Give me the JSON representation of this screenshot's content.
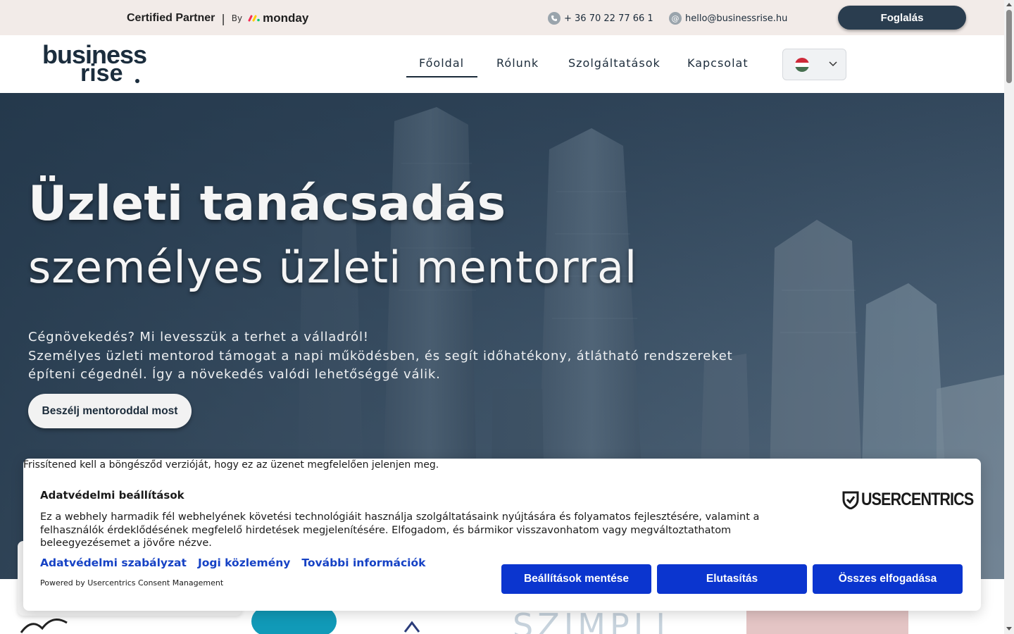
{
  "topbar": {
    "partner_label": "Certified Partner",
    "separator": "|",
    "by_label": "By",
    "brand": "monday",
    "phone": "+ 36 70 22 77 66 1",
    "email": "hello@businessrise.hu",
    "book_button": "Foglalás",
    "phone_icon": "phone-icon",
    "email_icon": "at-icon"
  },
  "logo": {
    "line1": "business",
    "line2": "rise"
  },
  "nav": {
    "items": [
      "Főoldal",
      "Rólunk",
      "Szolgáltatások",
      "Kapcsolat"
    ],
    "active": "Főoldal",
    "language_flag": "hungary-flag-icon"
  },
  "hero": {
    "title": "Üzleti tanácsadás",
    "subtitle": "személyes üzleti mentorral",
    "paragraph_lines": [
      "Cégnövekedés? Mi levesszük a terhet a válladról!",
      "Személyes üzleti mentorod támogat a napi működésben, és segít időhatékony, átlátható rendszereket",
      "építeni cégednél. Így a növekedés valódi lehetőséggé válik."
    ],
    "cta": "Beszélj mentoroddal most"
  },
  "consent": {
    "update_note": "Frissítened kell a böngésződ verzióját, hogy ez az üzenet megfelelően jelenjen meg.",
    "title": "Adatvédelmi beállítások",
    "provider_logo": "USERCENTRICS",
    "description": "Ez a webhely harmadik fél webhelyének követési technológiáit használja szolgáltatásaink nyújtására és folyamatos fejlesztésére, valamint a felhasználók érdeklődésének megfelelő hirdetések megjelenítésére. Elfogadom, és bármikor visszavonhatom vagy megváltoztathatom beleegyezésemet a jövőre nézve.",
    "links": [
      "Adatvédelmi szabályzat",
      "Jogi közlemény",
      "További információk"
    ],
    "powered_by": "Powered by Usercentrics Consent Management",
    "buttons": {
      "save": "Beállítások mentése",
      "deny": "Elutasítás",
      "accept_all": "Összes elfogadása"
    }
  },
  "colors": {
    "topbar_bg": "#f2ebe8",
    "navy": "#2a3d4f",
    "consent_blue": "#0b35cf",
    "link_blue": "#1642c5"
  }
}
